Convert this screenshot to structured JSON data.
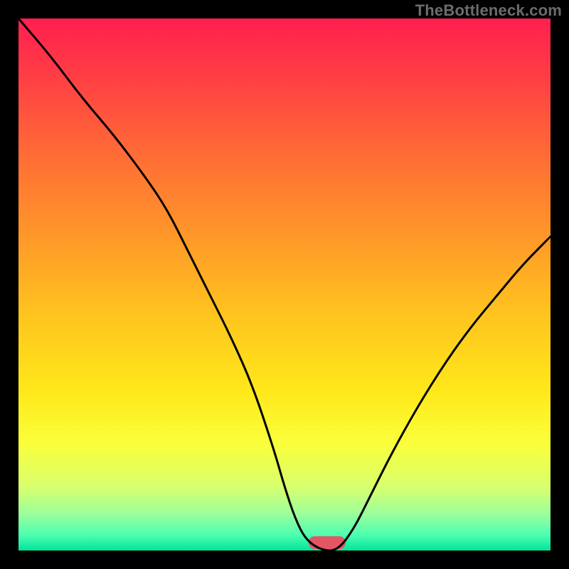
{
  "watermark": "TheBottleneck.com",
  "chart_data": {
    "type": "line",
    "title": "",
    "xlabel": "",
    "ylabel": "",
    "xlim": [
      0,
      100
    ],
    "ylim": [
      0,
      100
    ],
    "grid": false,
    "legend": false,
    "annotations": [],
    "series": [
      {
        "name": "curve",
        "x": [
          0,
          6,
          12,
          18,
          24,
          28,
          32,
          36,
          40,
          44,
          48,
          50,
          52,
          54,
          57,
          60,
          63,
          66,
          70,
          75,
          80,
          85,
          90,
          95,
          100
        ],
        "values": [
          100,
          93,
          85,
          78,
          70,
          64,
          56,
          48,
          40,
          31,
          19,
          12,
          6,
          2,
          0,
          0,
          4,
          10,
          18,
          27,
          35,
          42,
          48,
          54,
          59
        ]
      }
    ],
    "background_gradient": {
      "stops": [
        {
          "offset": 0.0,
          "color": "#ff1f4f"
        },
        {
          "offset": 0.1,
          "color": "#ff3b45"
        },
        {
          "offset": 0.25,
          "color": "#ff6a36"
        },
        {
          "offset": 0.4,
          "color": "#ff952a"
        },
        {
          "offset": 0.55,
          "color": "#ffc21f"
        },
        {
          "offset": 0.7,
          "color": "#ffe81a"
        },
        {
          "offset": 0.8,
          "color": "#faff3c"
        },
        {
          "offset": 0.88,
          "color": "#d8ff6e"
        },
        {
          "offset": 0.93,
          "color": "#9dff9a"
        },
        {
          "offset": 0.97,
          "color": "#4fffb0"
        },
        {
          "offset": 1.0,
          "color": "#00e59b"
        }
      ]
    },
    "marker": {
      "x_center": 58,
      "width": 7,
      "color": "#e35664"
    },
    "frame": {
      "border_color": "#000000",
      "border_width": 26
    }
  }
}
